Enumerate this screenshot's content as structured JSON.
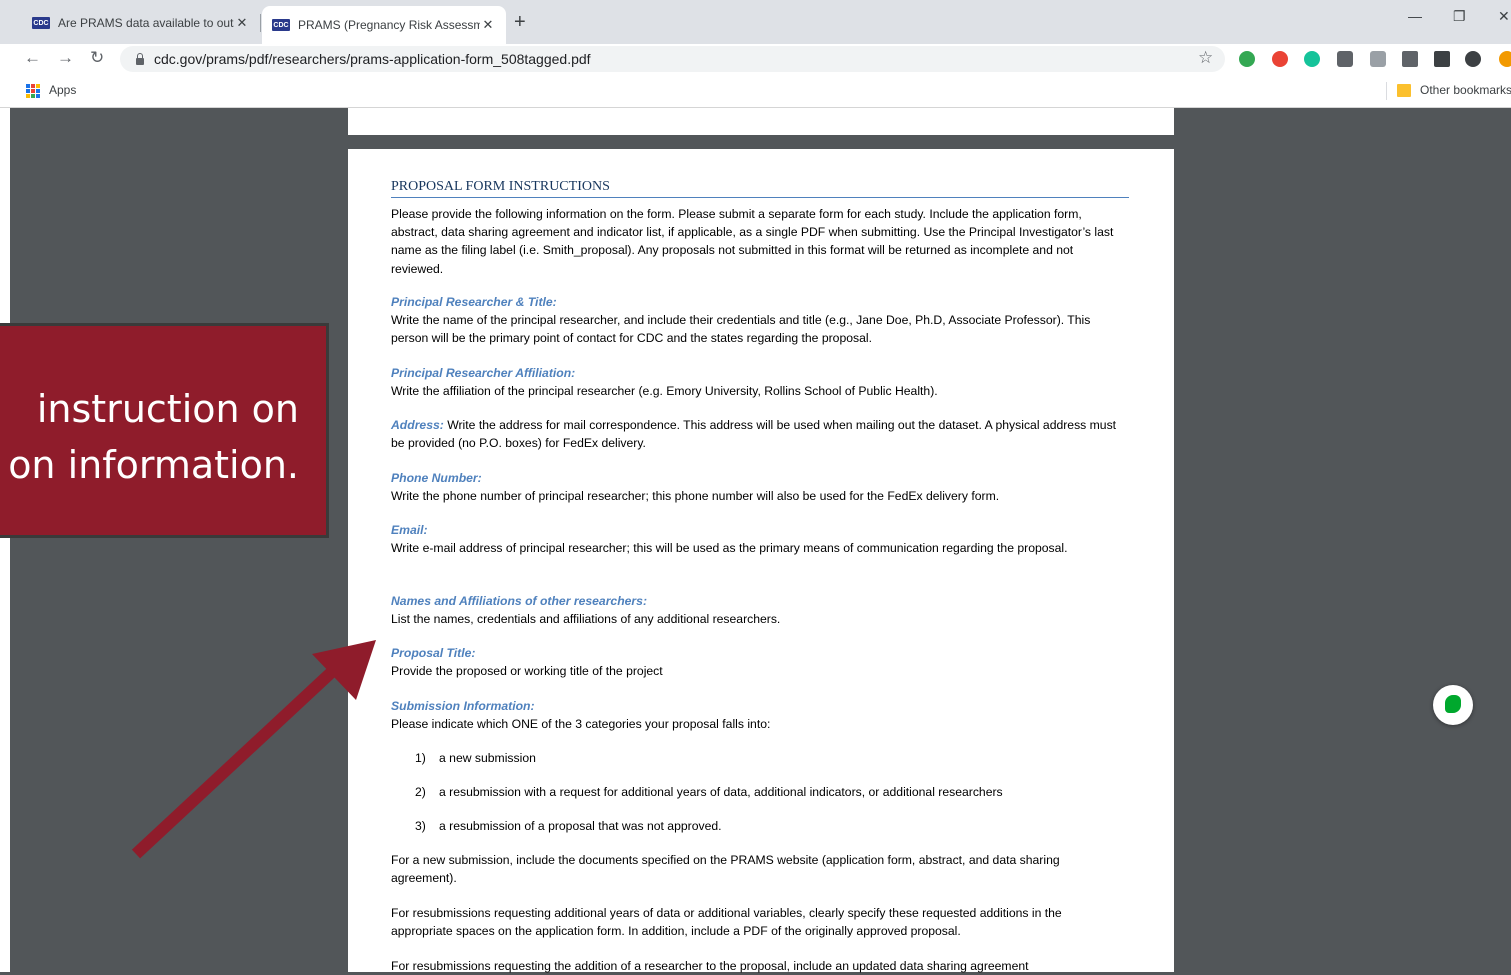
{
  "browser": {
    "tabs": [
      {
        "favicon": "CDC",
        "title": "Are PRAMS data available to outs",
        "active": false
      },
      {
        "favicon": "CDC",
        "title": "PRAMS (Pregnancy Risk Assessm",
        "active": true
      }
    ],
    "url": "cdc.gov/prams/pdf/researchers/prams-application-form_508tagged.pdf",
    "bookmarks": {
      "apps_label": "Apps",
      "other_label": "Other bookmarks"
    },
    "extension_colors": [
      "#34a853",
      "#ea4335",
      "#15c39a",
      "#5f6368",
      "#9aa0a6",
      "#5f6368",
      "#3c4043",
      "#f29900"
    ]
  },
  "document": {
    "heading": "PROPOSAL FORM INSTRUCTIONS",
    "intro": "Please provide the following information on the form. Please submit a separate form for each study. Include the application form, abstract, data sharing agreement and indicator list, if applicable, as a single PDF when submitting. Use the Principal Investigator’s last name as the filing label (i.e. Smith_proposal). Any proposals not submitted in this format will be returned as incomplete and not reviewed.",
    "sections": {
      "researcher_title": {
        "heading": "Principal Researcher & Title:",
        "body": "Write the name of the principal researcher, and include their credentials and title (e.g., Jane Doe, Ph.D, Associate Professor). This person will be the primary point of contact for CDC and the states regarding the proposal."
      },
      "affiliation": {
        "heading": "Principal Researcher Affiliation:",
        "body": "Write the affiliation of the principal researcher (e.g. Emory University, Rollins School of Public Health)."
      },
      "address": {
        "heading": "Address:",
        "body": " Write the address for mail correspondence. This address will be used when mailing out the dataset. A physical address must be provided (no P.O. boxes) for FedEx delivery."
      },
      "phone": {
        "heading": "Phone Number:",
        "body": "Write the phone number of principal researcher; this phone number will also be used for the FedEx delivery form."
      },
      "email": {
        "heading": "Email:",
        "body": "Write e-mail address of principal researcher; this will be used as the primary means of communication regarding the proposal."
      },
      "other_researchers": {
        "heading": "Names and Affiliations of other researchers:",
        "body": "List the names, credentials and affiliations of any additional researchers."
      },
      "proposal_title": {
        "heading": "Proposal Title:",
        "body": "Provide the proposed or working title of the project"
      },
      "submission": {
        "heading": "Submission Information:",
        "body": "Please indicate which ONE of the 3 categories your proposal falls into:",
        "items": [
          {
            "num": "1)",
            "text": "a new submission"
          },
          {
            "num": "2)",
            "text": "a resubmission with a request for additional years of data, additional indicators, or additional researchers"
          },
          {
            "num": "3)",
            "text": "a resubmission of a proposal that was not approved."
          }
        ]
      }
    },
    "new_submission_note": "For a new submission, include the documents specified on the PRAMS website (application form, abstract, and data sharing agreement).",
    "resubmission_note": "For resubmissions requesting additional years of data or additional variables, clearly specify these requested additions in the appropriate spaces on the application form. In addition, include a PDF of the originally approved proposal.",
    "researcher_addition_note": "For resubmissions requesting the addition of a researcher to the proposal, include an updated data sharing agreement"
  },
  "annotation": {
    "text": "instruction on\non information.",
    "color": "#8f1c2b"
  }
}
